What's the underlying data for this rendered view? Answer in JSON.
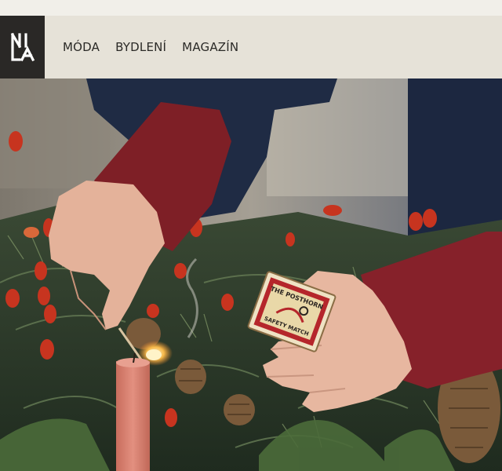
{
  "brand": {
    "logo_text": "NILA",
    "logo_icon": "nila-logo-icon"
  },
  "nav": {
    "items": [
      {
        "label": "MÓDA"
      },
      {
        "label": "BYDLENÍ"
      },
      {
        "label": "MAGAZÍN"
      }
    ]
  },
  "hero": {
    "matchbox_brand": "THE POSTHORN",
    "matchbox_subtitle": "SAFETY MATCH"
  },
  "colors": {
    "topbar": "#f1efe9",
    "header": "#e6e2d8",
    "logo_bg": "#2a2826",
    "nav_text": "#2b2a27"
  }
}
